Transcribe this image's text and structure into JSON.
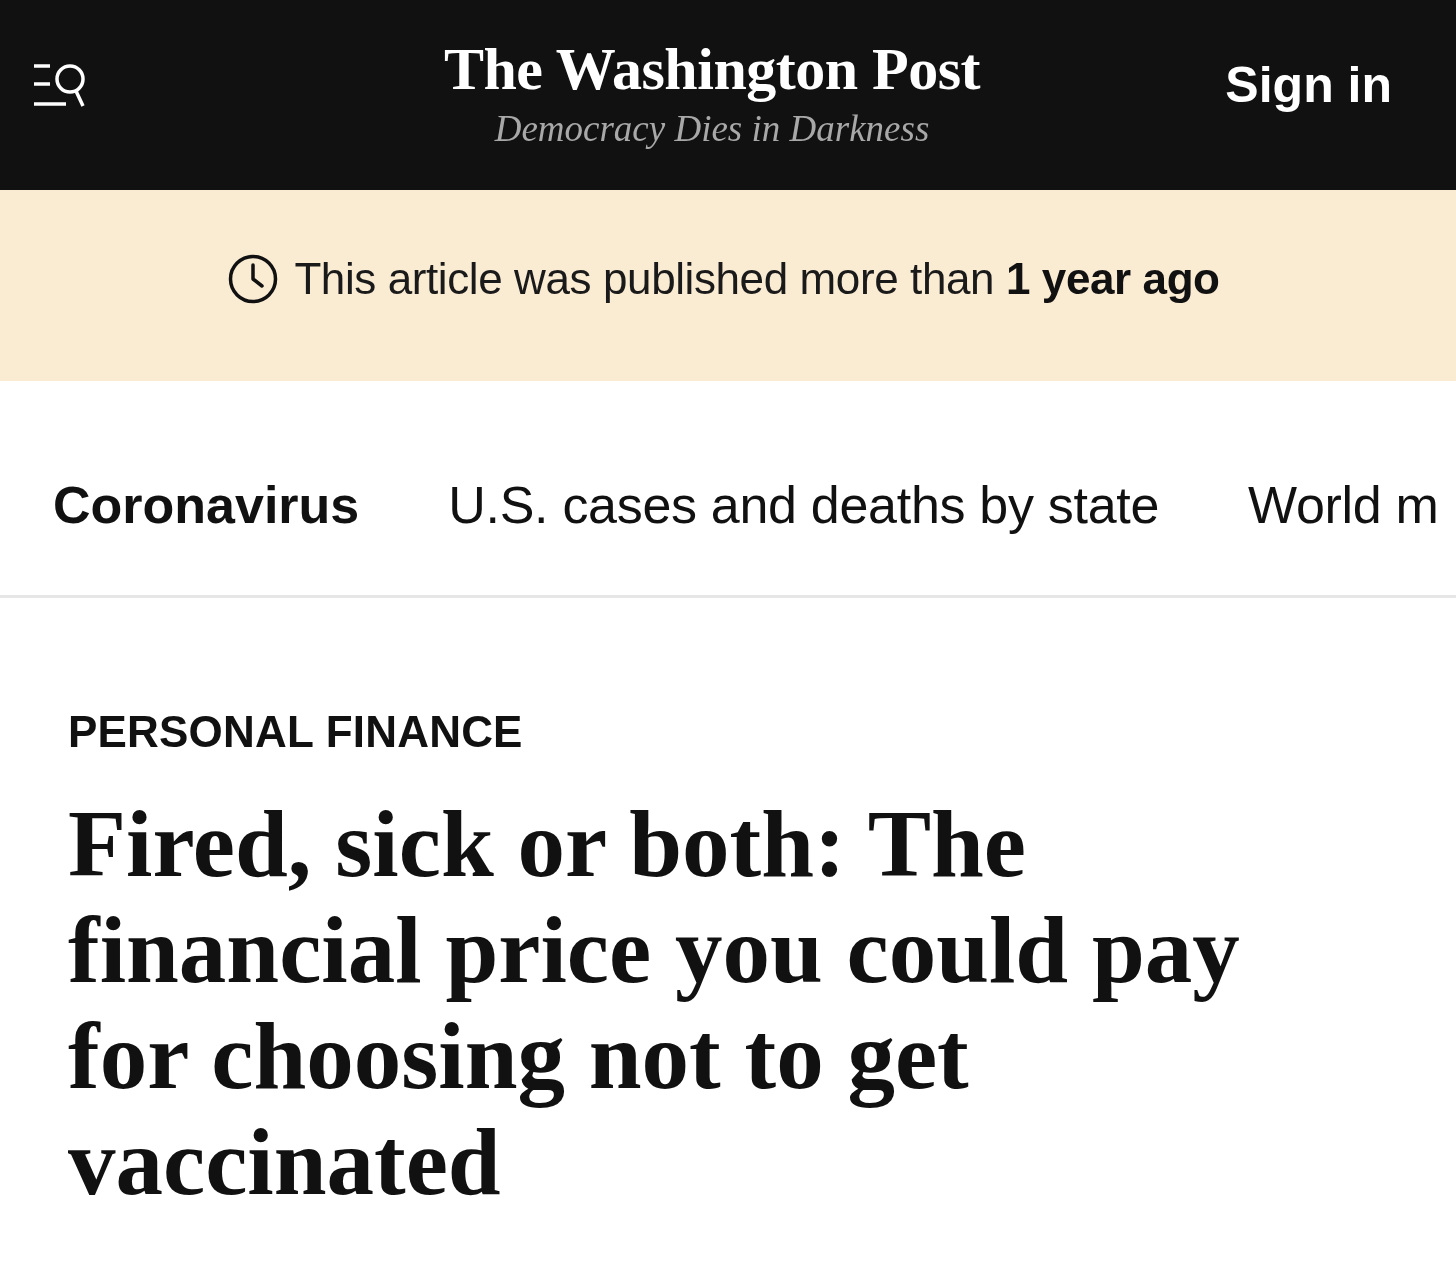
{
  "header": {
    "logo": "The Washington Post",
    "tagline": "Democracy Dies in Darkness",
    "sign_in": "Sign in"
  },
  "notice": {
    "text": "This article was published more than **1 year ago**"
  },
  "nav": {
    "items": [
      {
        "label": "Coronavirus",
        "selected": true
      },
      {
        "label": "U.S. cases and deaths by state",
        "selected": false
      },
      {
        "label": "World m",
        "selected": false
      }
    ]
  },
  "article": {
    "section": "PERSONAL FINANCE",
    "headline": "Fired, sick or both: The financial price you could pay for choosing not to get vaccinated"
  }
}
